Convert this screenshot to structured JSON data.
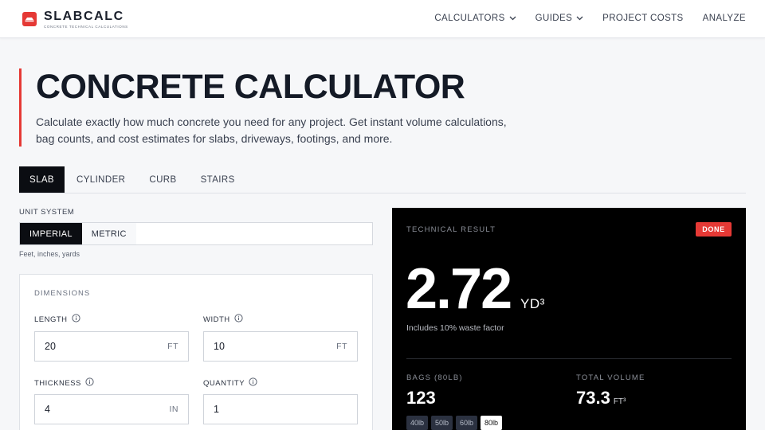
{
  "header": {
    "brand_name": "SLABCALC",
    "brand_tagline": "CONCRETE TECHNICAL CALCULATIONS",
    "nav": [
      {
        "label": "CALCULATORS",
        "has_dropdown": true
      },
      {
        "label": "GUIDES",
        "has_dropdown": true
      },
      {
        "label": "PROJECT COSTS",
        "has_dropdown": false
      },
      {
        "label": "ANALYZE",
        "has_dropdown": false
      }
    ]
  },
  "hero": {
    "title": "CONCRETE CALCULATOR",
    "description": "Calculate exactly how much concrete you need for any project. Get instant volume calculations, bag counts, and cost estimates for slabs, driveways, footings, and more."
  },
  "tabs": [
    {
      "label": "SLAB",
      "active": true
    },
    {
      "label": "CYLINDER",
      "active": false
    },
    {
      "label": "CURB",
      "active": false
    },
    {
      "label": "STAIRS",
      "active": false
    }
  ],
  "unit_system": {
    "label": "UNIT SYSTEM",
    "options": [
      {
        "label": "IMPERIAL",
        "active": true
      },
      {
        "label": "METRIC",
        "active": false
      }
    ],
    "hint": "Feet, inches, yards"
  },
  "dimensions": {
    "title": "DIMENSIONS",
    "length": {
      "label": "LENGTH",
      "value": "20",
      "unit": "FT"
    },
    "width": {
      "label": "WIDTH",
      "value": "10",
      "unit": "FT"
    },
    "thickness": {
      "label": "THICKNESS",
      "value": "4",
      "unit": "IN"
    },
    "quantity": {
      "label": "QUANTITY",
      "value": "1",
      "unit": ""
    }
  },
  "result": {
    "label": "TECHNICAL RESULT",
    "status": "DONE",
    "volume": "2.72",
    "volume_unit": "YD³",
    "waste_note": "Includes 10% waste factor",
    "bags_label": "BAGS (80LB)",
    "bags_value": "123",
    "total_label": "TOTAL VOLUME",
    "total_value": "73.3",
    "total_unit": "FT³",
    "bag_sizes": [
      {
        "label": "40lb",
        "active": false
      },
      {
        "label": "50lb",
        "active": false
      },
      {
        "label": "60lb",
        "active": false
      },
      {
        "label": "80lb",
        "active": true
      }
    ]
  },
  "colors": {
    "accent": "#e53935",
    "dark": "#0b0d12",
    "page_bg": "#f6f7f9"
  }
}
